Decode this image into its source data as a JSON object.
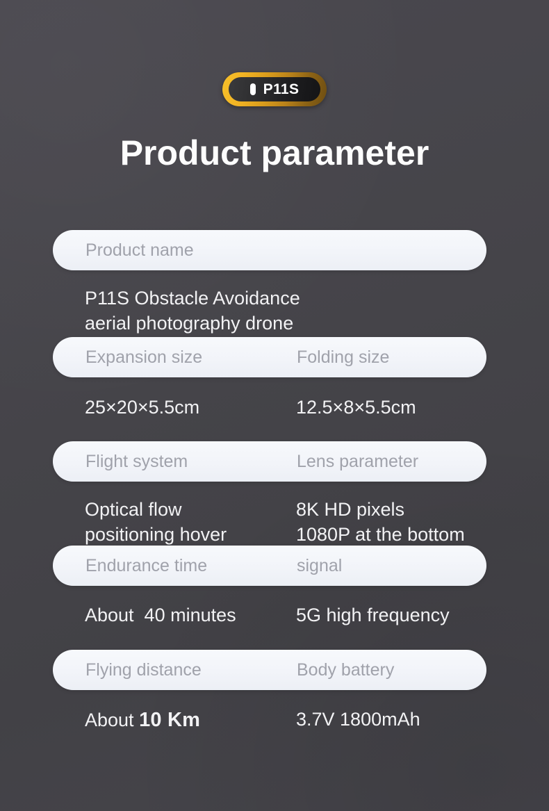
{
  "badge": {
    "bar_icon": "vertical-bar-icon",
    "model": "P11S",
    "border_color": "#f3b524",
    "inner_color": "#1c1c1e"
  },
  "header": {
    "title": "Product parameter"
  },
  "theme": {
    "background": "#45444a",
    "pill_background": "#f4f6fa",
    "pill_label_color": "#a0a2ab",
    "value_color": "#f2f2f4"
  },
  "spec_rows": [
    {
      "labels": [
        "Product name"
      ],
      "values": [
        "P11S Obstacle Avoidance\naerial photography drone"
      ]
    },
    {
      "labels": [
        "Expansion size",
        "Folding size"
      ],
      "values": [
        "25×20×5.5cm",
        "12.5×8×5.5cm"
      ]
    },
    {
      "labels": [
        "Flight system",
        "Lens parameter"
      ],
      "values": [
        "Optical flow\npositioning hover",
        "8K HD pixels\n1080P at the bottom"
      ]
    },
    {
      "labels": [
        "Endurance time",
        "signal"
      ],
      "values": [
        "About  40 minutes",
        "5G high frequency"
      ]
    },
    {
      "labels": [
        "Flying distance",
        "Body battery"
      ],
      "values": [
        "About ",
        "3.7V 1800mAh"
      ],
      "value_emphasis": "10 Km"
    }
  ]
}
